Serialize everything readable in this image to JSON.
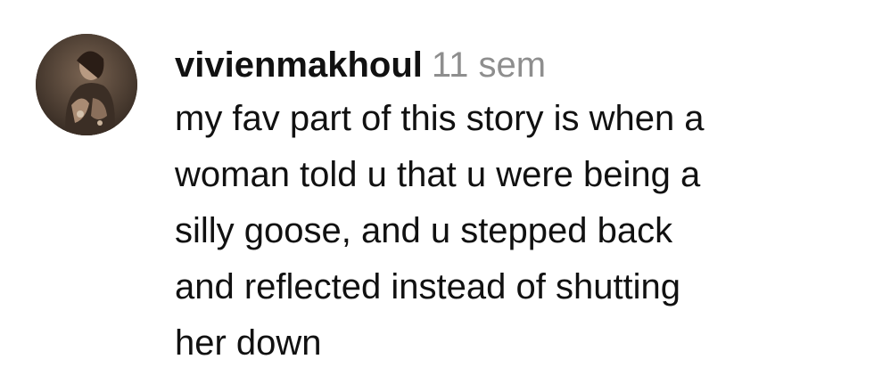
{
  "comment": {
    "username": "vivienmakhoul",
    "timestamp": "11 sem",
    "avatar_icon": "user-avatar-photo",
    "text_lines": [
      "my fav part of this story is when a",
      "woman told u that u were being a",
      "silly goose, and u stepped back",
      "and reflected instead of shutting",
      "her down"
    ]
  },
  "colors": {
    "username": "#111111",
    "timestamp": "#8e8e8e",
    "text": "#111111",
    "background": "#ffffff"
  }
}
